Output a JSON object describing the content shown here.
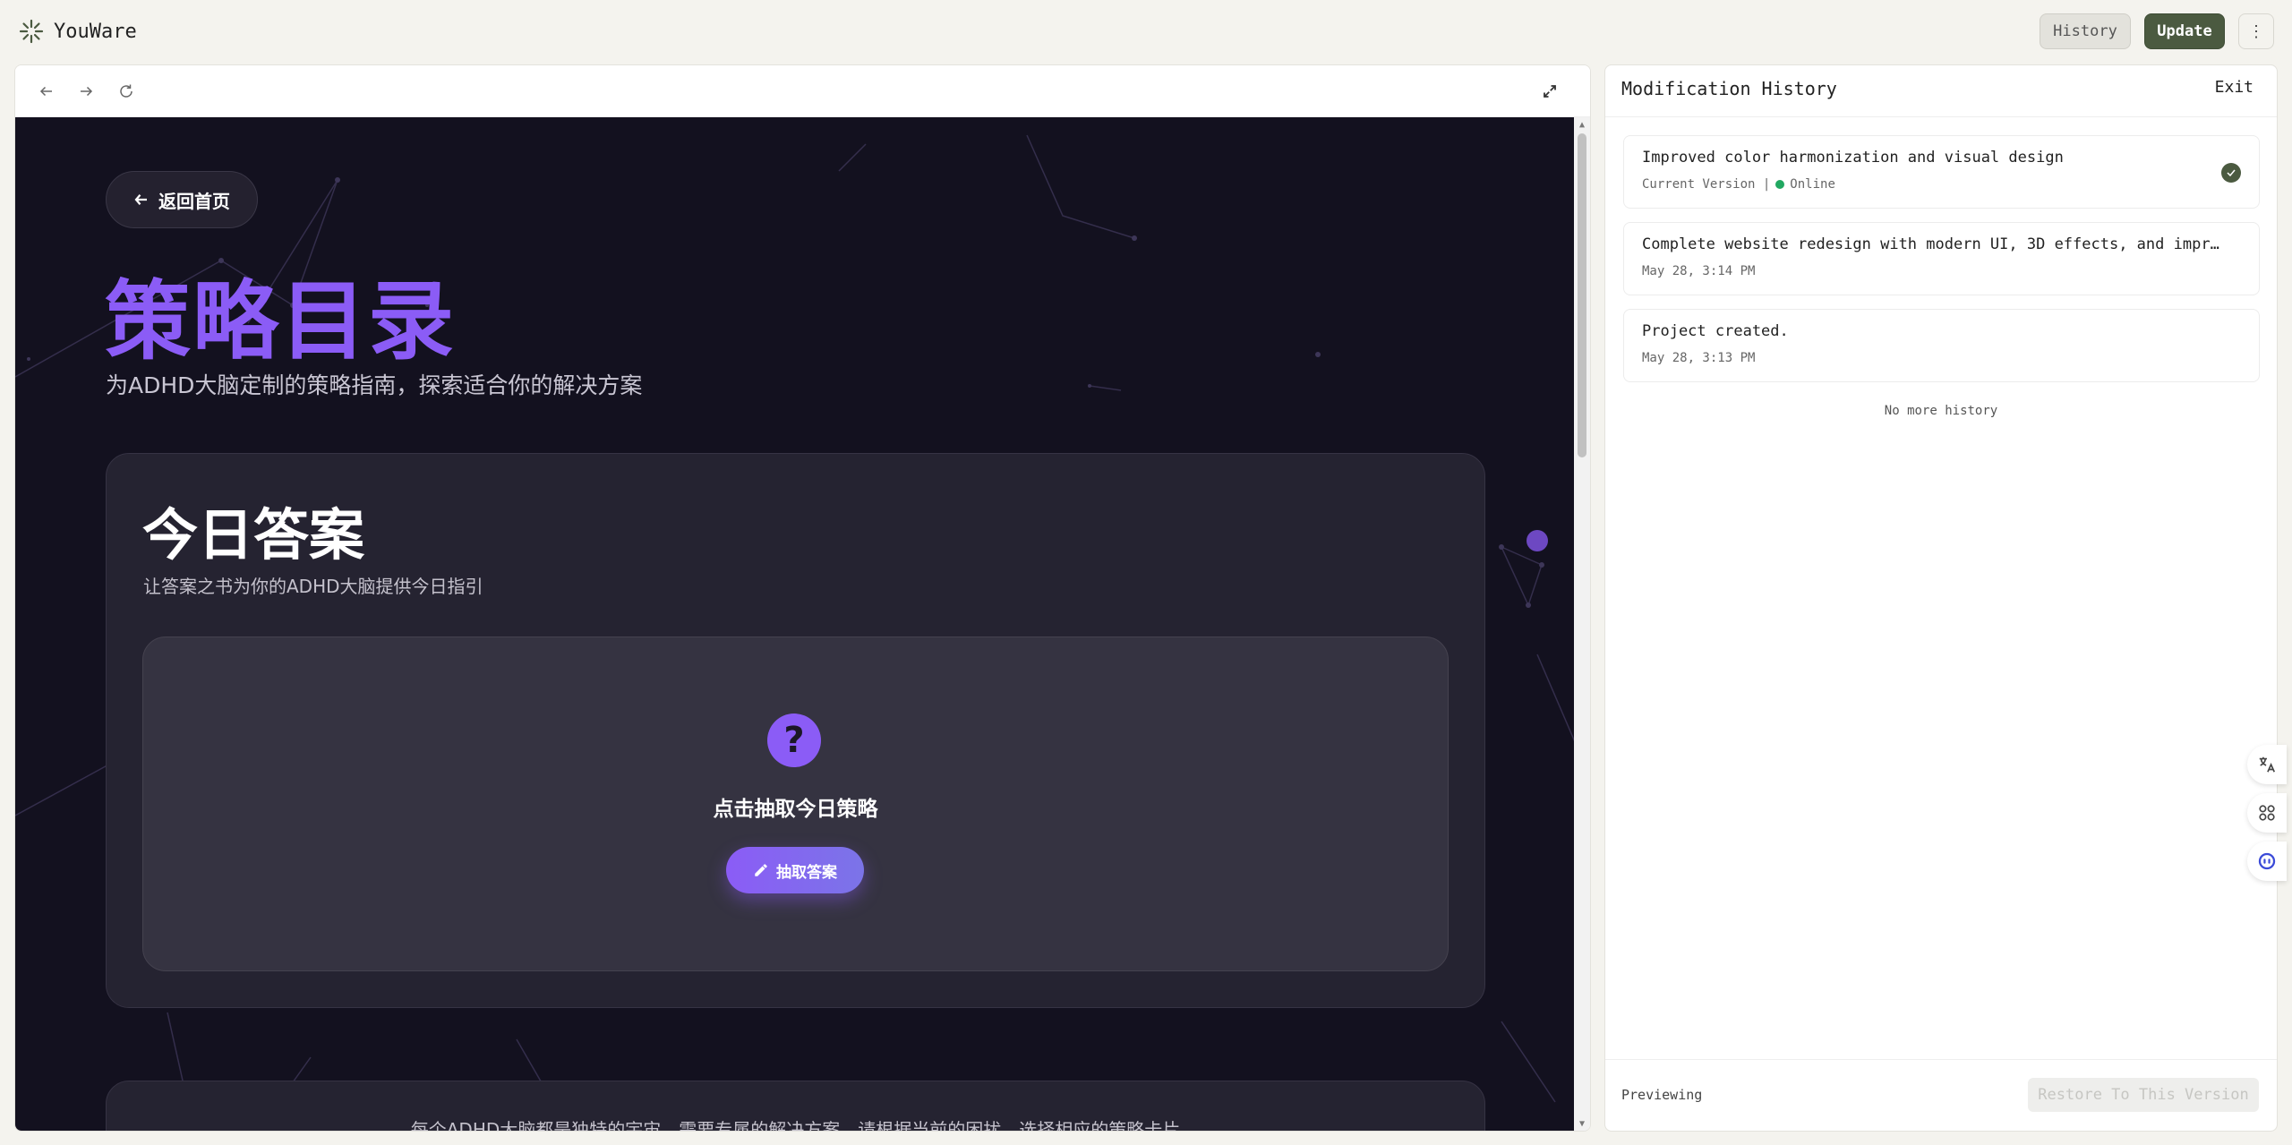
{
  "app": {
    "name": "YouWare",
    "history_label": "History",
    "update_label": "Update",
    "more_label": "⋮"
  },
  "site": {
    "back_label": "返回首页",
    "title": "策略目录",
    "subtitle": "为ADHD大脑定制的策略指南，探索适合你的解决方案",
    "card": {
      "title": "今日答案",
      "description": "让答案之书为你的ADHD大脑提供今日指引",
      "question_mark": "?",
      "prompt": "点击抽取今日策略",
      "button_label": "抽取答案"
    },
    "card2_text": "每个ADHD大脑都是独特的宇宙，需要专属的解决方案。请根据当前的困扰，选择相应的策略卡片"
  },
  "history": {
    "title": "Modification History",
    "exit_label": "Exit",
    "items": [
      {
        "title": "Improved color harmonization and visual design",
        "subtitle": "Current Version |",
        "status": "Online"
      },
      {
        "title": "Complete website redesign with modern UI, 3D effects, and improv…",
        "subtitle": "May 28, 3:14 PM"
      },
      {
        "title": "Project created.",
        "subtitle": "May 28, 3:13 PM"
      }
    ],
    "no_more": "No more history",
    "previewing": "Previewing",
    "restore_label": "Restore To This Version"
  },
  "colors": {
    "accent_purple": "#8b5cf6",
    "update_green": "#4b5a40",
    "online_green": "#22a861",
    "site_bg": "#13111f"
  }
}
